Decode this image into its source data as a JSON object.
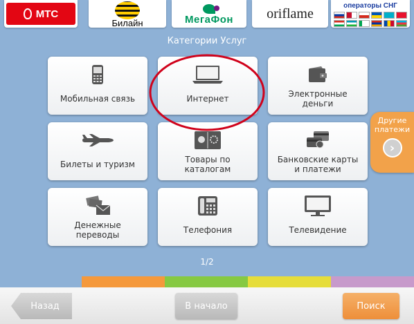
{
  "operators": {
    "mts_label": "МТС",
    "beeline_label": "Билайн",
    "megafon_label": "МегаФон",
    "oriflame_label": "oriflame",
    "sng_label": "операторы СНГ"
  },
  "header": {
    "title": "Категории Услуг"
  },
  "categories": [
    {
      "label": "Мобильная связь",
      "icon": "mobile-phone-icon"
    },
    {
      "label": "Интернет",
      "icon": "laptop-icon"
    },
    {
      "label": "Электронные\nденьги",
      "icon": "wallet-icon"
    },
    {
      "label": "Билеты и туризм",
      "icon": "airplane-icon"
    },
    {
      "label": "Товары по\nкаталогам",
      "icon": "catalog-icon"
    },
    {
      "label": "Банковские карты\nи платежи",
      "icon": "bank-card-icon"
    },
    {
      "label": "Денежные\nпереводы",
      "icon": "money-transfer-icon"
    },
    {
      "label": "Телефония",
      "icon": "desk-phone-icon"
    },
    {
      "label": "Телевидение",
      "icon": "tv-icon"
    }
  ],
  "side": {
    "other_payments_label": "Другие платежи"
  },
  "pagination": {
    "current": "1/2"
  },
  "footer": {
    "back_label": "Назад",
    "home_label": "В начало",
    "search_label": "Поиск"
  },
  "colors": {
    "background": "#8eb1d6",
    "accent_orange": "#ee8f3a",
    "highlight_red": "#d0021b",
    "strip": [
      "#8eb1d6",
      "#f5993c",
      "#86c942",
      "#e6dd3a",
      "#c79acb"
    ]
  }
}
